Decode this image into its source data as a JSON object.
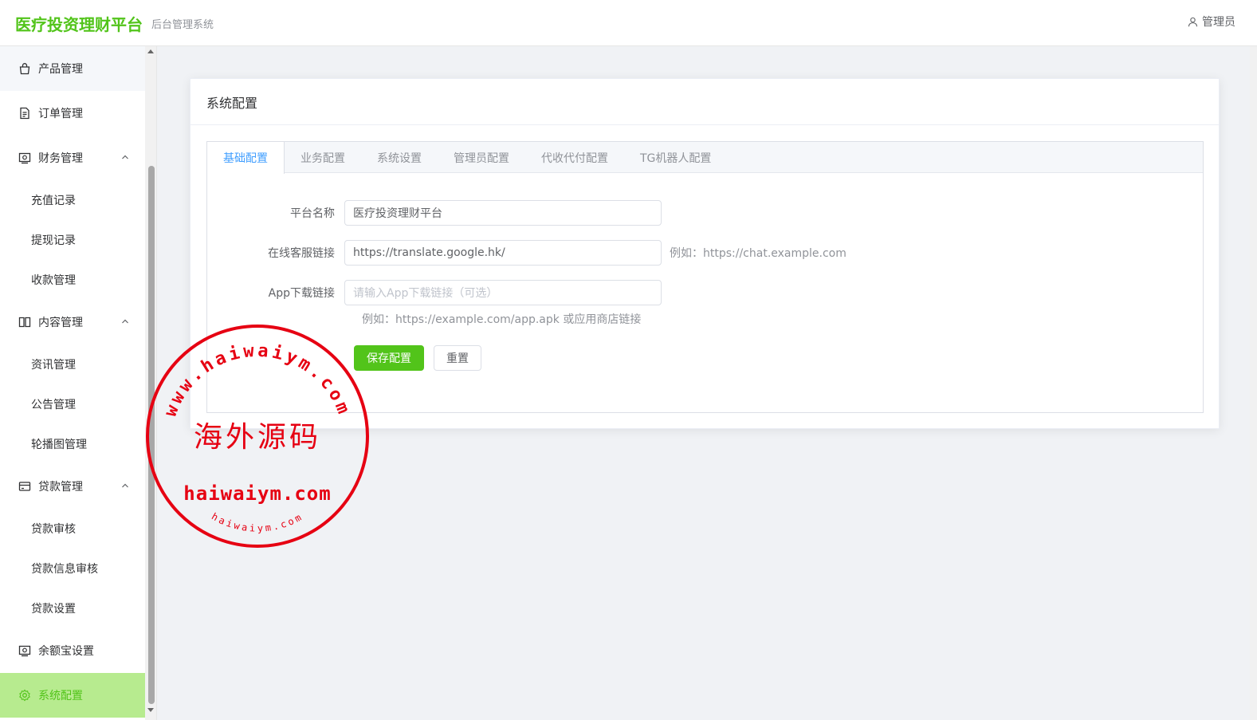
{
  "header": {
    "logo": "医疗投资理财平台",
    "subtitle": "后台管理系统",
    "user": "管理员",
    "user_icon": "user-icon"
  },
  "sidebar": {
    "items": [
      {
        "label": "产品管理",
        "icon": "bag-icon"
      },
      {
        "label": "订单管理",
        "icon": "document-icon"
      },
      {
        "label": "财务管理",
        "icon": "wallet-icon",
        "children": [
          "充值记录",
          "提现记录",
          "收款管理"
        ]
      },
      {
        "label": "内容管理",
        "icon": "book-icon",
        "children": [
          "资讯管理",
          "公告管理",
          "轮播图管理"
        ]
      },
      {
        "label": "贷款管理",
        "icon": "card-icon",
        "children": [
          "贷款审核",
          "贷款信息审核",
          "贷款设置"
        ]
      },
      {
        "label": "余额宝设置",
        "icon": "wallet-icon"
      },
      {
        "label": "系统配置",
        "icon": "gear-icon"
      }
    ]
  },
  "card": {
    "title": "系统配置",
    "tabs": [
      "基础配置",
      "业务配置",
      "系统设置",
      "管理员配置",
      "代收代付配置",
      "TG机器人配置"
    ],
    "form": {
      "platform_name": {
        "label": "平台名称",
        "value": "医疗投资理财平台"
      },
      "service_link": {
        "label": "在线客服链接",
        "value": "https://translate.google.hk/",
        "hint": "例如：https://chat.example.com"
      },
      "app_link": {
        "label": "App下载链接",
        "placeholder": "请输入App下载链接（可选）",
        "hint": "例如：https://example.com/app.apk 或应用商店链接"
      },
      "save_label": "保存配置",
      "reset_label": "重置"
    }
  },
  "watermark": {
    "center_text": "海外源码",
    "domain_text": "haiwaiym.com",
    "arc_text": "www.haiwaiym.com",
    "small_arc_text": "haiwaiym.com",
    "color": "#e60012"
  }
}
